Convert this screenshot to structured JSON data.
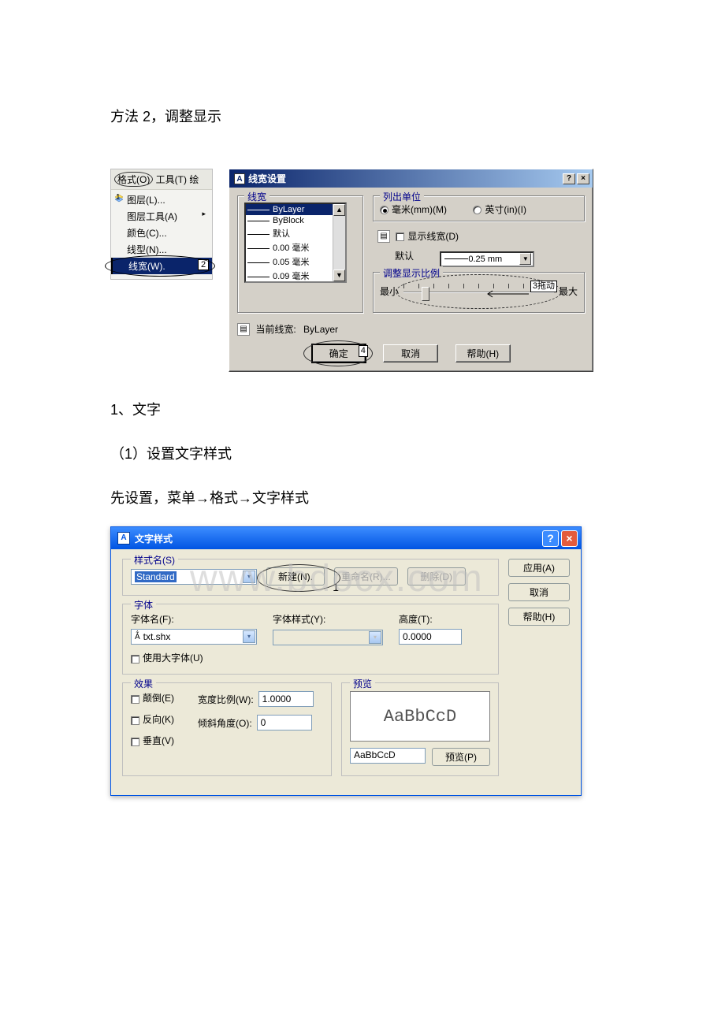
{
  "text": {
    "method_line": "方法 2，调整显示",
    "sec1": "1、文字",
    "sec1_sub": "（1）设置文字样式",
    "sec1_body": "先设置，菜单→格式→文字样式"
  },
  "watermark": "www.bdocx.com",
  "menu": {
    "top_format": "格式(O)",
    "top_tools": "工具(T)",
    "top_extra": "绘",
    "items": [
      {
        "icon": "layer",
        "num": "1",
        "label": "图层(L)..."
      },
      {
        "label": "图层工具(A)"
      },
      {
        "label": "颜色(C)..."
      },
      {
        "label": "线型(N)..."
      },
      {
        "label": "线宽(W).",
        "num": "2",
        "highlight": true
      }
    ]
  },
  "lw": {
    "title": "线宽设置",
    "group_lw": "线宽",
    "list": [
      {
        "label": "ByLayer",
        "selected": true
      },
      {
        "label": "ByBlock"
      },
      {
        "label": "默认"
      },
      {
        "label": "0.00 毫米"
      },
      {
        "label": "0.05 毫米"
      },
      {
        "label": "0.09 毫米"
      }
    ],
    "group_units": "列出单位",
    "unit_mm": "毫米(mm)(M)",
    "unit_in": "英寸(in)(I)",
    "show_lw": "显示线宽(D)",
    "default_label": "默认",
    "default_value": "0.25 mm",
    "group_scale": "调整显示比例",
    "min": "最小",
    "max": "最大",
    "annot_drag": "3拖动",
    "current_lw_label": "当前线宽:",
    "current_lw_value": "ByLayer",
    "ok": "确定",
    "ok_annot": "4",
    "cancel": "取消",
    "help": "帮助(H)"
  },
  "ts": {
    "title": "文字样式",
    "group_name": "样式名(S)",
    "name_value": "Standard",
    "btn_new": "新建(N).",
    "btn_new_annot": "1",
    "btn_rename": "重命名(R)...",
    "btn_delete": "删除(D)",
    "group_font": "字体",
    "font_name_label": "字体名(F):",
    "font_name_value": "txt.shx",
    "font_style_label": "字体样式(Y):",
    "font_style_value": "",
    "height_label": "高度(T):",
    "height_value": "0.0000",
    "use_big": "使用大字体(U)",
    "group_effect": "效果",
    "upside": "颠倒(E)",
    "backward": "反向(K)",
    "vertical": "垂直(V)",
    "width_label": "宽度比例(W):",
    "width_value": "1.0000",
    "oblique_label": "倾斜角度(O):",
    "oblique_value": "0",
    "group_preview": "预览",
    "preview_sample": "AaBbCcD",
    "preview_input": "AaBbCcD",
    "btn_preview": "预览(P)",
    "btn_apply": "应用(A)",
    "btn_cancel": "取消",
    "btn_help": "帮助(H)"
  }
}
